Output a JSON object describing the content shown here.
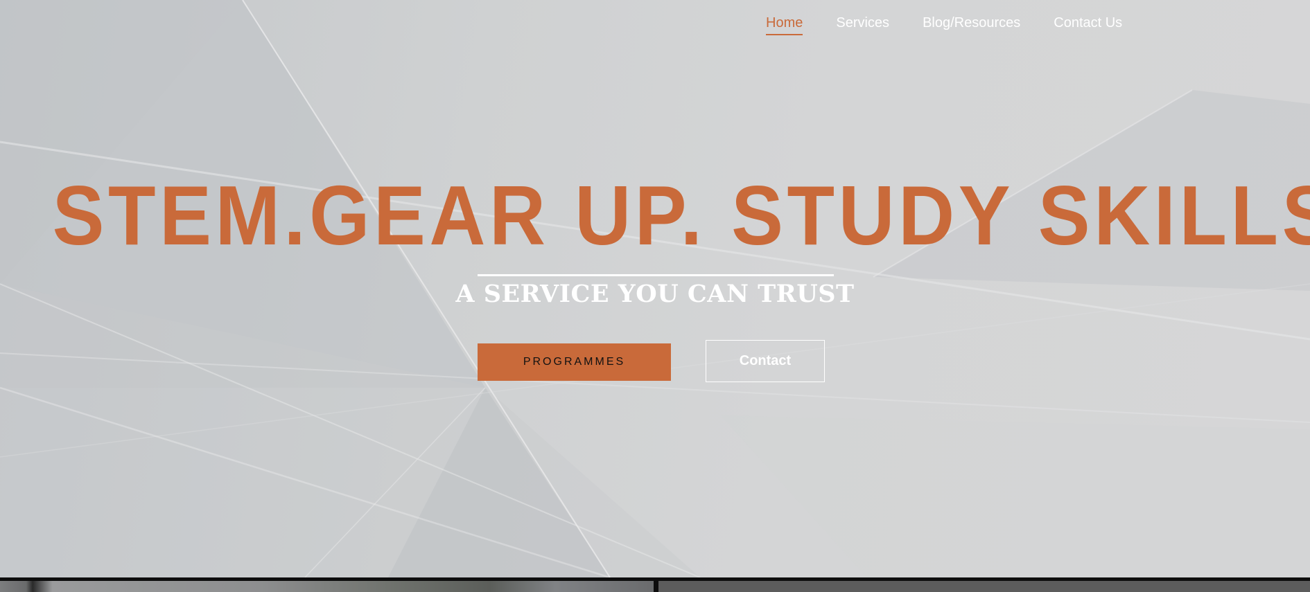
{
  "nav": {
    "items": [
      {
        "label": "Home",
        "active": true
      },
      {
        "label": "Services",
        "active": false
      },
      {
        "label": "Blog/Resources",
        "active": false
      },
      {
        "label": "Contact Us",
        "active": false
      }
    ]
  },
  "hero": {
    "headline": "STEM.GEAR UP. STUDY SKILLS.",
    "subtitle": "A SERVICE YOU CAN TRUST",
    "primary_button": "PROGRAMMES",
    "secondary_button": "Contact"
  },
  "colors": {
    "accent": "#c96a3a",
    "background": "#d2d3d4",
    "text_light": "#ffffff"
  }
}
